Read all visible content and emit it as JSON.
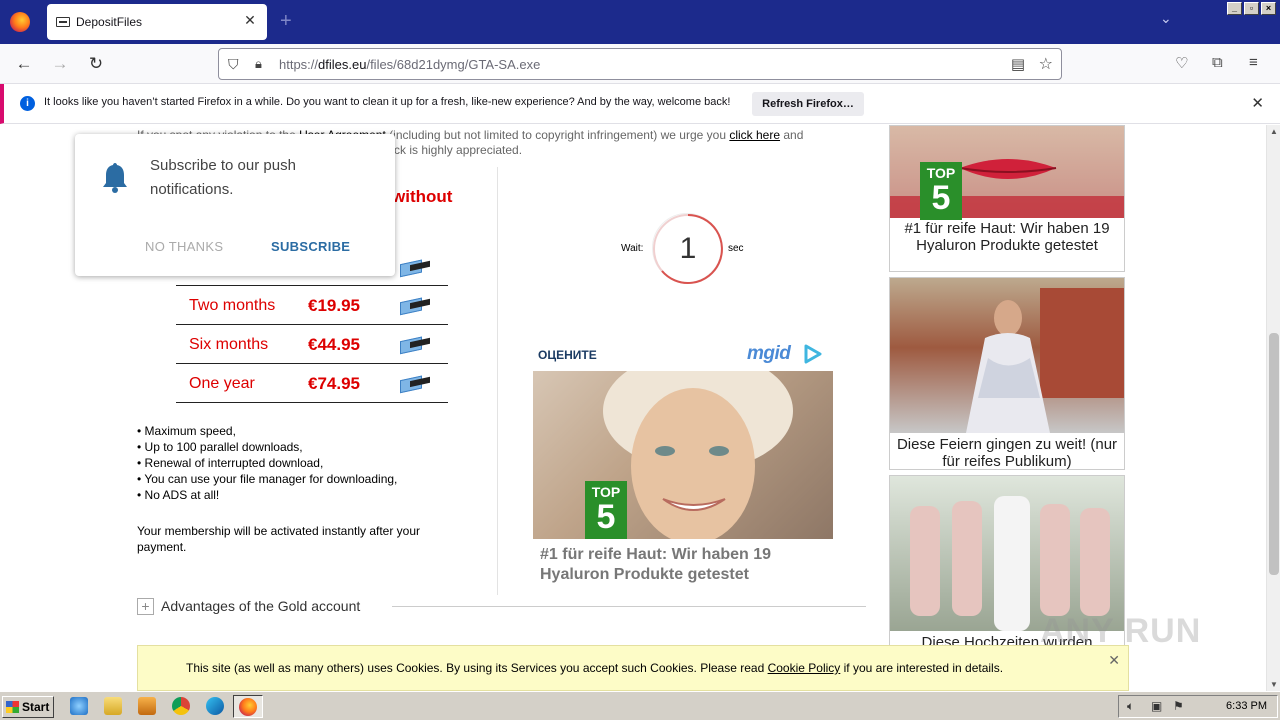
{
  "browser": {
    "tab_title": "DepositFiles",
    "tab_close": "✕",
    "new_tab": "+",
    "url_prefix": "https://",
    "url_domain": "dfiles.eu",
    "url_path": "/files/68d21dymg/GTA-SA.exe"
  },
  "notification": {
    "message": "It looks like you haven’t started Firefox in a while. Do you want to clean it up for a fresh, like-new experience? And by the way, welcome back!",
    "button": "Refresh Firefox…",
    "close": "✕"
  },
  "page": {
    "violation_start": "If you spot any violation to the ",
    "violation_link1": "User Agreement",
    "violation_mid": " (including but not limited to copyright infringement) we urge you ",
    "violation_link2": "click here",
    "violation_end": " and",
    "violation_line2": "ck is highly appreciated.",
    "without_heading": "without",
    "plans": [
      {
        "period": "Two months",
        "price": "€19.95"
      },
      {
        "period": "Six months",
        "price": "€44.95"
      },
      {
        "period": "One year",
        "price": "€74.95"
      }
    ],
    "features": [
      "• Maximum speed,",
      "• Up to 100 parallel downloads,",
      "• Renewal of interrupted download,",
      "• You can use your file manager for downloading,",
      "• No ADS at all!"
    ],
    "activation": "Your membership will be activated instantly after your payment.",
    "advantages_plus": "+",
    "advantages": "Advantages of the Gold account",
    "timer": {
      "wait": "Wait:",
      "value": "1",
      "unit": "sec"
    },
    "ad_header": "ОЦЕНИТЕ",
    "ad_brand": "mgid",
    "ad_main_text": "#1 für reife Haut: Wir haben 19 Hyaluron Produkte getestet",
    "top5_label": "TOP",
    "top5_num": "5",
    "right_ads": [
      {
        "caption": "#1 für reife Haut: Wir haben 19 Hyaluron Produkte getestet"
      },
      {
        "caption": "Diese Feiern gingen zu weit! (nur für reifes Publikum)"
      },
      {
        "caption": "Diese Hochzeiten wurden"
      }
    ]
  },
  "push_popup": {
    "message": "Subscribe to our push notifications.",
    "no_thanks": "NO THANKS",
    "subscribe": "SUBSCRIBE"
  },
  "cookie_bar": {
    "text_before": "This site (as well as many others) uses Cookies. By using its Services you accept such Cookies. Please read ",
    "link": "Cookie Policy",
    "text_after": " if you are interested in details.",
    "close": "✕"
  },
  "watermark": "ANY RUN",
  "taskbar": {
    "start": "Start",
    "clock": "6:33 PM"
  }
}
